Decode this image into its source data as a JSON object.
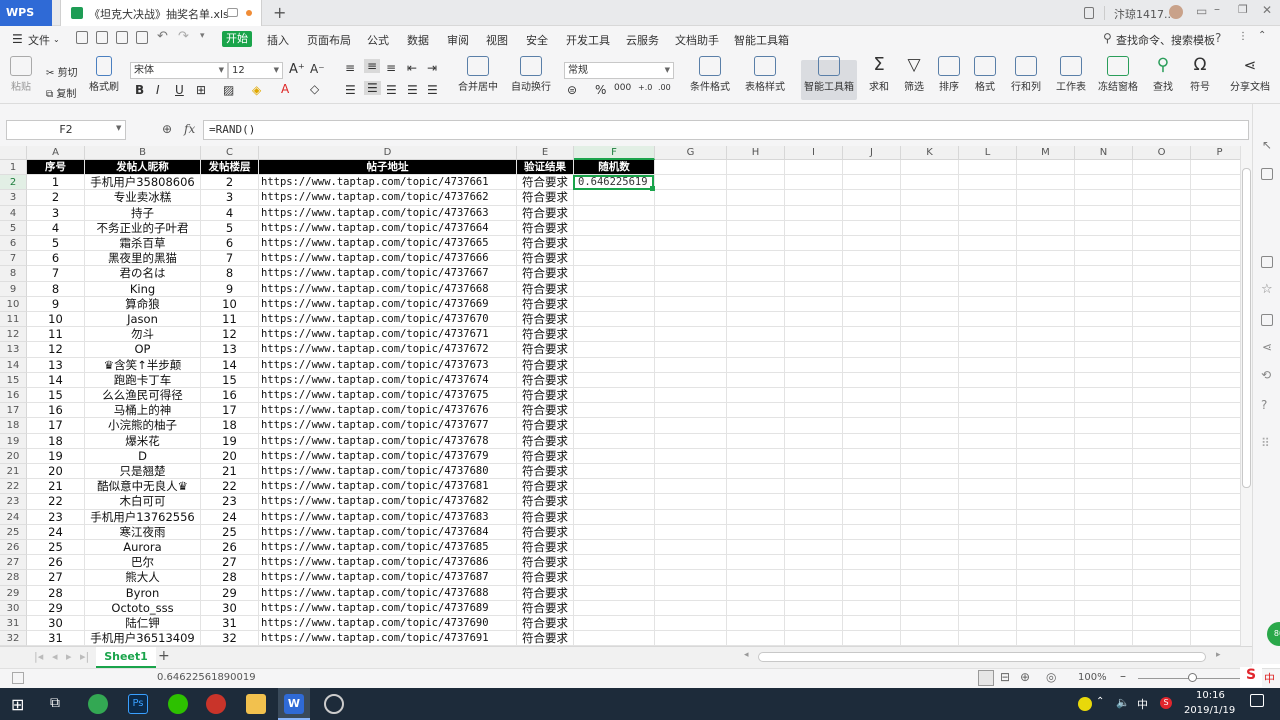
{
  "app": {
    "name": "WPS",
    "doc_title": "《坦克大决战》抽奖名单.xls",
    "user": "汴琼1417..."
  },
  "menu": {
    "file": "文件",
    "start": "开始",
    "items": [
      "插入",
      "页面布局",
      "公式",
      "数据",
      "审阅",
      "视图",
      "安全",
      "开发工具",
      "云服务",
      "文档助手",
      "智能工具箱"
    ],
    "search": "查找命令、搜索模板"
  },
  "ribbon": {
    "paste": "粘贴",
    "cut": "剪切",
    "copy": "复制",
    "format_painter": "格式刷",
    "font": "宋体",
    "font_size": "12",
    "number_format": "常规",
    "merge": "合并居中",
    "wrap": "自动换行",
    "cond_format": "条件格式",
    "table_style": "表格样式",
    "smart_tools": "智能工具箱",
    "sum": "求和",
    "filter": "筛选",
    "sort": "排序",
    "format": "格式",
    "rowcol": "行和列",
    "worksheet": "工作表",
    "freeze": "冻结窗格",
    "find": "查找",
    "symbol": "符号",
    "share": "分享文档"
  },
  "formula_bar": {
    "cell_ref": "F2",
    "fx": "fx",
    "formula": "=RAND()"
  },
  "columns": [
    "A",
    "B",
    "C",
    "D",
    "E",
    "F",
    "G",
    "H",
    "I",
    "J",
    "K",
    "L",
    "M",
    "N",
    "O",
    "P"
  ],
  "headers": [
    "序号",
    "发帖人昵称",
    "发帖楼层",
    "帖子地址",
    "验证结果",
    "随机数"
  ],
  "active_value": "0.646225619",
  "rows": [
    [
      "1",
      "手机用户35808606",
      "2",
      "https://www.taptap.com/topic/4737661",
      "符合要求"
    ],
    [
      "2",
      "专业卖冰糕",
      "3",
      "https://www.taptap.com/topic/4737662",
      "符合要求"
    ],
    [
      "3",
      "持子",
      "4",
      "https://www.taptap.com/topic/4737663",
      "符合要求"
    ],
    [
      "4",
      "不务正业的子叶君",
      "5",
      "https://www.taptap.com/topic/4737664",
      "符合要求"
    ],
    [
      "5",
      "霜杀百草",
      "6",
      "https://www.taptap.com/topic/4737665",
      "符合要求"
    ],
    [
      "6",
      "黑夜里的黑猫",
      "7",
      "https://www.taptap.com/topic/4737666",
      "符合要求"
    ],
    [
      "7",
      "君の名は",
      "8",
      "https://www.taptap.com/topic/4737667",
      "符合要求"
    ],
    [
      "8",
      "King",
      "9",
      "https://www.taptap.com/topic/4737668",
      "符合要求"
    ],
    [
      "9",
      "算命狼",
      "10",
      "https://www.taptap.com/topic/4737669",
      "符合要求"
    ],
    [
      "10",
      "Jason",
      "11",
      "https://www.taptap.com/topic/4737670",
      "符合要求"
    ],
    [
      "11",
      "勿斗",
      "12",
      "https://www.taptap.com/topic/4737671",
      "符合要求"
    ],
    [
      "12",
      "OP",
      "13",
      "https://www.taptap.com/topic/4737672",
      "符合要求"
    ],
    [
      "13",
      "♛含笑↑半步颠",
      "14",
      "https://www.taptap.com/topic/4737673",
      "符合要求"
    ],
    [
      "14",
      "跑跑卡丁车",
      "15",
      "https://www.taptap.com/topic/4737674",
      "符合要求"
    ],
    [
      "15",
      "么么渔民可得径",
      "16",
      "https://www.taptap.com/topic/4737675",
      "符合要求"
    ],
    [
      "16",
      "马桶上的神",
      "17",
      "https://www.taptap.com/topic/4737676",
      "符合要求"
    ],
    [
      "17",
      "小浣熊的柚子",
      "18",
      "https://www.taptap.com/topic/4737677",
      "符合要求"
    ],
    [
      "18",
      "爆米花",
      "19",
      "https://www.taptap.com/topic/4737678",
      "符合要求"
    ],
    [
      "19",
      "D",
      "20",
      "https://www.taptap.com/topic/4737679",
      "符合要求"
    ],
    [
      "20",
      "只是翘楚",
      "21",
      "https://www.taptap.com/topic/4737680",
      "符合要求"
    ],
    [
      "21",
      "酷似意中无良人♛",
      "22",
      "https://www.taptap.com/topic/4737681",
      "符合要求"
    ],
    [
      "22",
      "木白可可",
      "23",
      "https://www.taptap.com/topic/4737682",
      "符合要求"
    ],
    [
      "23",
      "手机用户13762556",
      "24",
      "https://www.taptap.com/topic/4737683",
      "符合要求"
    ],
    [
      "24",
      "寒江夜雨",
      "25",
      "https://www.taptap.com/topic/4737684",
      "符合要求"
    ],
    [
      "25",
      "Aurora",
      "26",
      "https://www.taptap.com/topic/4737685",
      "符合要求"
    ],
    [
      "26",
      "巴尔",
      "27",
      "https://www.taptap.com/topic/4737686",
      "符合要求"
    ],
    [
      "27",
      "熊大人",
      "28",
      "https://www.taptap.com/topic/4737687",
      "符合要求"
    ],
    [
      "28",
      "Byron",
      "29",
      "https://www.taptap.com/topic/4737688",
      "符合要求"
    ],
    [
      "29",
      "Octoto_sss",
      "30",
      "https://www.taptap.com/topic/4737689",
      "符合要求"
    ],
    [
      "30",
      "陆仁钾",
      "31",
      "https://www.taptap.com/topic/4737690",
      "符合要求"
    ],
    [
      "31",
      "手机用户36513409",
      "32",
      "https://www.taptap.com/topic/4737691",
      "符合要求"
    ]
  ],
  "sheet": {
    "tab": "Sheet1",
    "status_value": "0.64622561890019",
    "zoom": "100%"
  },
  "taskbar": {
    "time": "10:16",
    "date": "2019/1/19",
    "ime": "中",
    "ime2": "中"
  }
}
